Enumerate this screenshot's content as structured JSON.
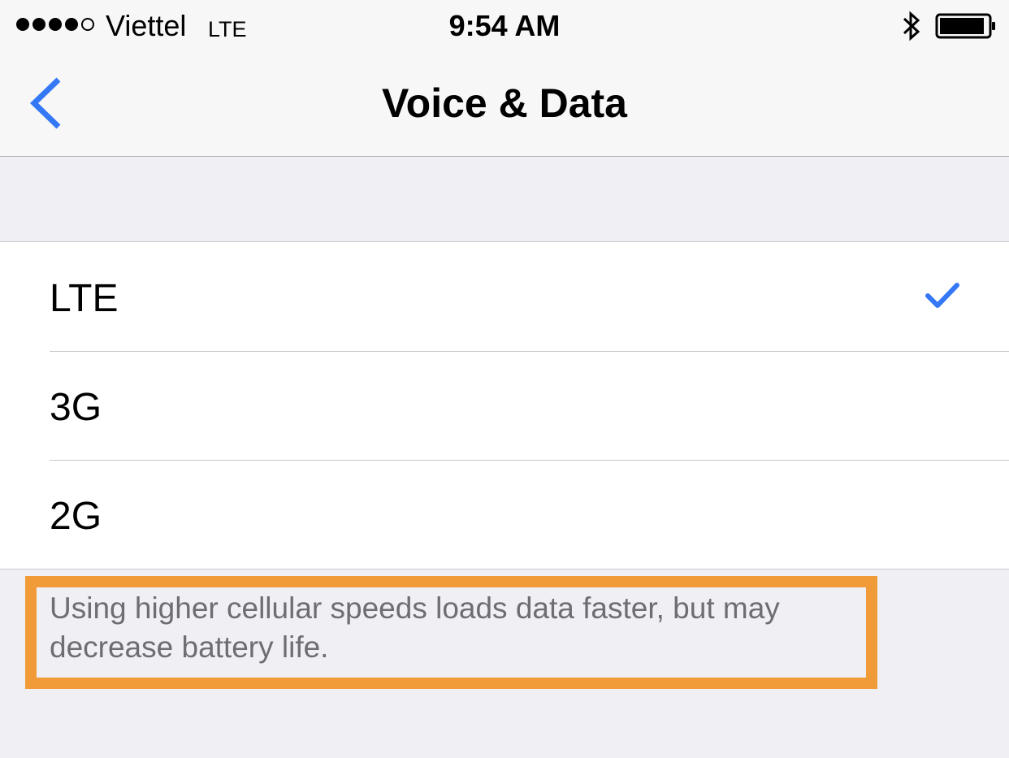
{
  "status_bar": {
    "signal_dots": [
      true,
      true,
      true,
      true,
      false
    ],
    "carrier": "Viettel",
    "network_type": "LTE",
    "time": "9:54 AM",
    "bluetooth_icon": "bluetooth-icon",
    "battery_icon": "battery-icon"
  },
  "nav": {
    "back_icon": "chevron-left-icon",
    "title": "Voice & Data"
  },
  "options": [
    {
      "label": "LTE",
      "selected": true
    },
    {
      "label": "3G",
      "selected": false
    },
    {
      "label": "2G",
      "selected": false
    }
  ],
  "footer_note": "Using higher cellular speeds loads data faster, but may decrease battery life.",
  "colors": {
    "accent": "#3478f6",
    "highlight_border": "#f19a38",
    "background": "#efeff4",
    "footer_text": "#6d6d72"
  }
}
